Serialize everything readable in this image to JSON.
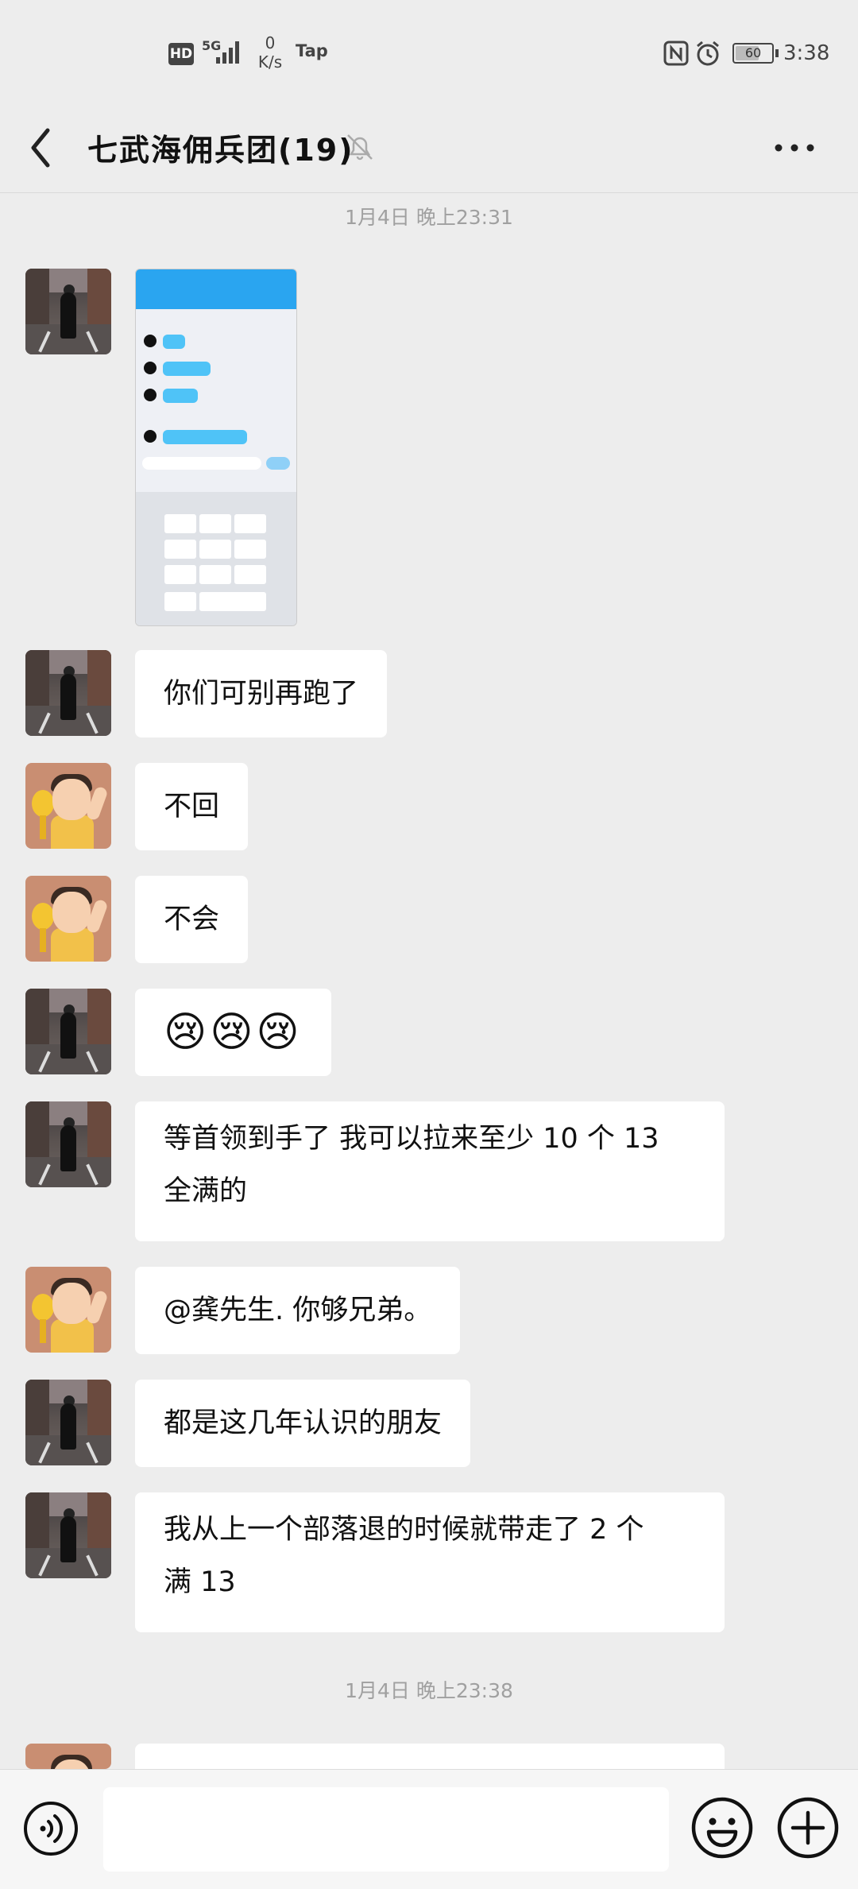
{
  "status_bar": {
    "hd": "HD",
    "network": "5G",
    "speed_value": "0",
    "speed_unit": "K/s",
    "tap": "Tap",
    "battery": "60",
    "time": "3:38"
  },
  "header": {
    "title": "七武海佣兵团(19)"
  },
  "timestamps": [
    "1月4日 晚上23:31",
    "1月4日 晚上23:38"
  ],
  "messages": [
    {
      "sender": "street",
      "type": "image"
    },
    {
      "sender": "street",
      "type": "text",
      "text": "你们可别再跑了"
    },
    {
      "sender": "cartoon",
      "type": "text",
      "text": "不回"
    },
    {
      "sender": "cartoon",
      "type": "text",
      "text": "不会"
    },
    {
      "sender": "street",
      "type": "emoji",
      "text": "😢😢😢"
    },
    {
      "sender": "street",
      "type": "text",
      "lines": [
        "等首领到手了 我可以拉来至少 10 个 13",
        "全满的"
      ]
    },
    {
      "sender": "cartoon",
      "type": "text",
      "text": "@龚先生. 你够兄弟。"
    },
    {
      "sender": "street",
      "type": "text",
      "text": "都是这几年认识的朋友"
    },
    {
      "sender": "street",
      "type": "text",
      "lines": [
        "我从上一个部落退的时候就带走了 2 个",
        "满 13"
      ]
    }
  ],
  "input": {
    "placeholder": "",
    "value": ""
  },
  "icons": {
    "back": "back-arrow-icon",
    "mute": "bell-muted-icon",
    "more": "more-dots-icon",
    "voice": "voice-icon",
    "emoji": "emoji-icon",
    "plus": "plus-icon"
  }
}
